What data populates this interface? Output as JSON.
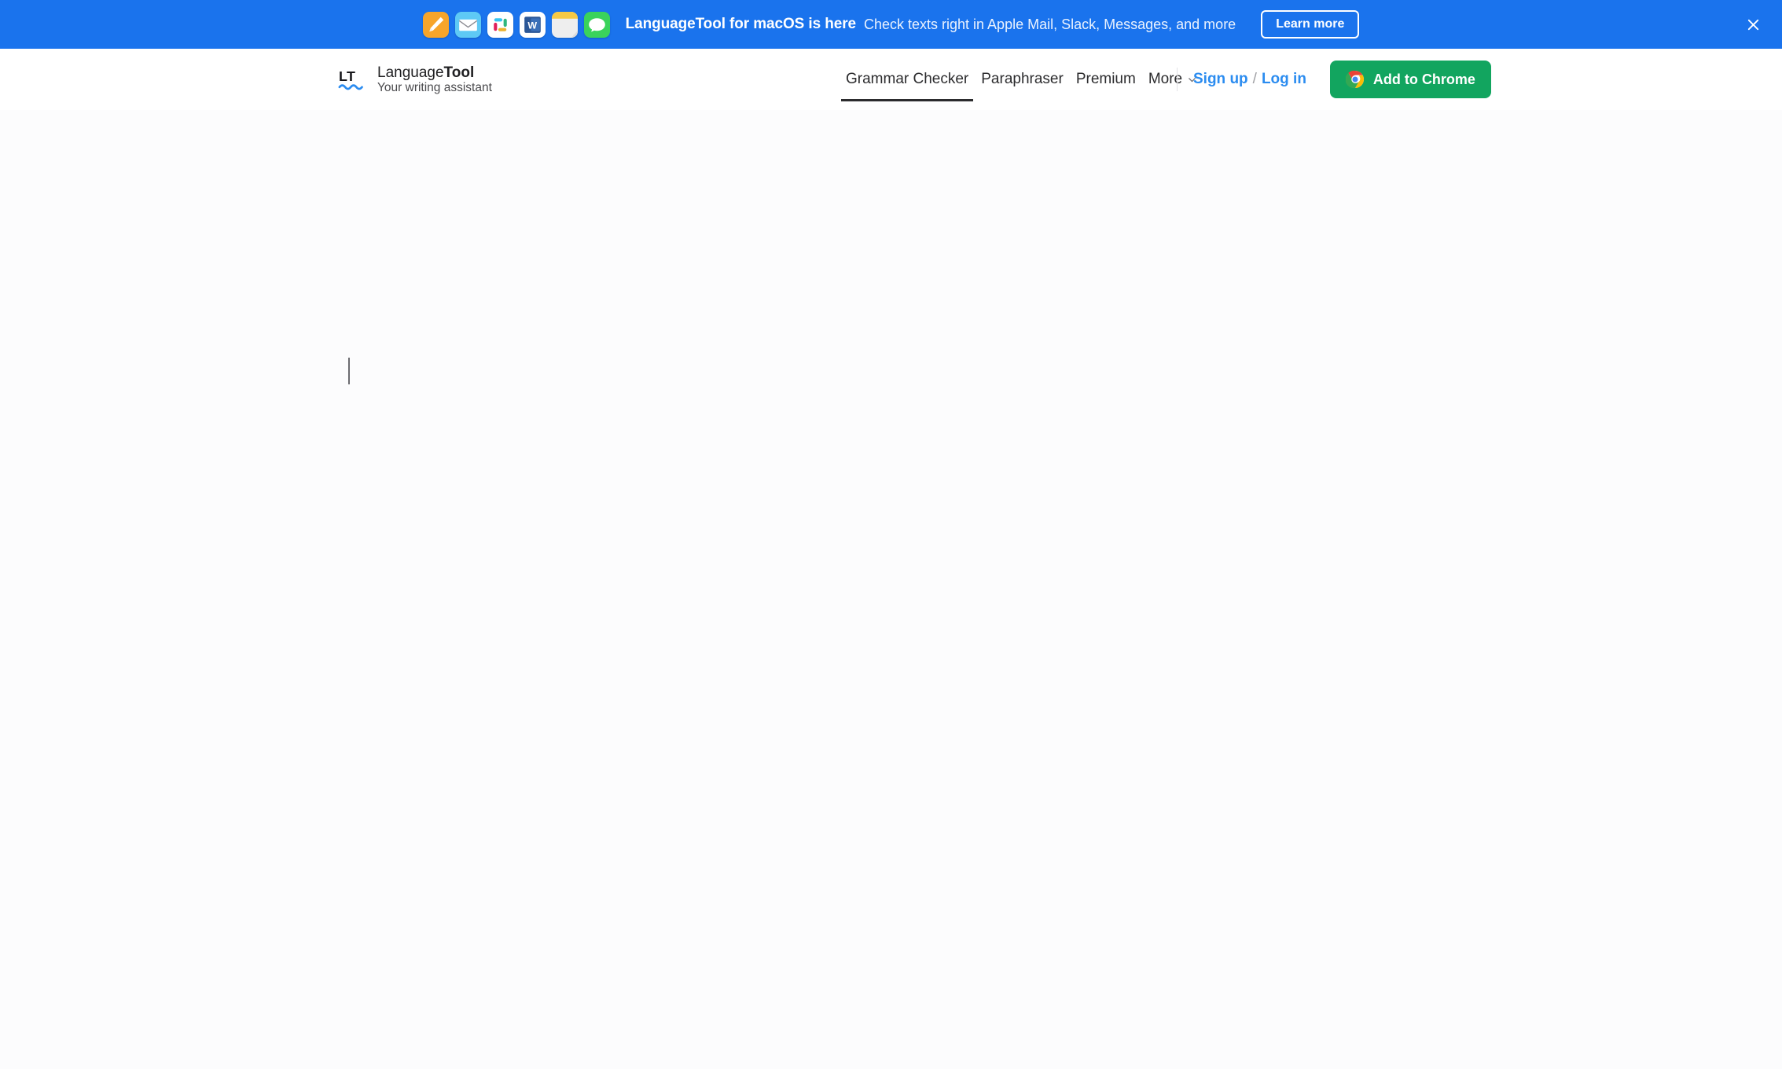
{
  "banner": {
    "title": "LanguageTool for macOS is here",
    "subtitle": "Check texts right in Apple Mail, Slack, Messages, and more",
    "cta_label": "Learn more",
    "close_icon": "close-icon",
    "background_color": "#1a73ed",
    "app_icons": [
      {
        "name": "apple-notes-icon",
        "color": "#f5a623"
      },
      {
        "name": "apple-mail-icon",
        "color": "#4fc3f7"
      },
      {
        "name": "slack-icon",
        "color": "#ffffff"
      },
      {
        "name": "microsoft-word-icon",
        "color": "#2b5797"
      },
      {
        "name": "stickies-icon",
        "color": "#f6c945"
      },
      {
        "name": "apple-messages-icon",
        "color": "#3ad35b"
      }
    ]
  },
  "header": {
    "brand": {
      "mark": "lt-logo-icon",
      "name_light": "Language",
      "name_bold": "Tool",
      "tagline": "Your writing assistant"
    },
    "nav": [
      {
        "label": "Grammar Checker",
        "active": true,
        "has_chevron": false
      },
      {
        "label": "Paraphraser",
        "active": false,
        "has_chevron": false
      },
      {
        "label": "Premium",
        "active": false,
        "has_chevron": false
      },
      {
        "label": "More",
        "active": false,
        "has_chevron": true
      }
    ],
    "auth": {
      "signup_label": "Sign up",
      "separator": "/",
      "login_label": "Log in",
      "link_color": "#2b8cf0"
    },
    "chrome_button": {
      "label": "Add to Chrome",
      "icon": "chrome-icon",
      "color": "#12a55f"
    }
  },
  "editor": {
    "content": "",
    "placeholder": "",
    "caret_visible": true
  }
}
